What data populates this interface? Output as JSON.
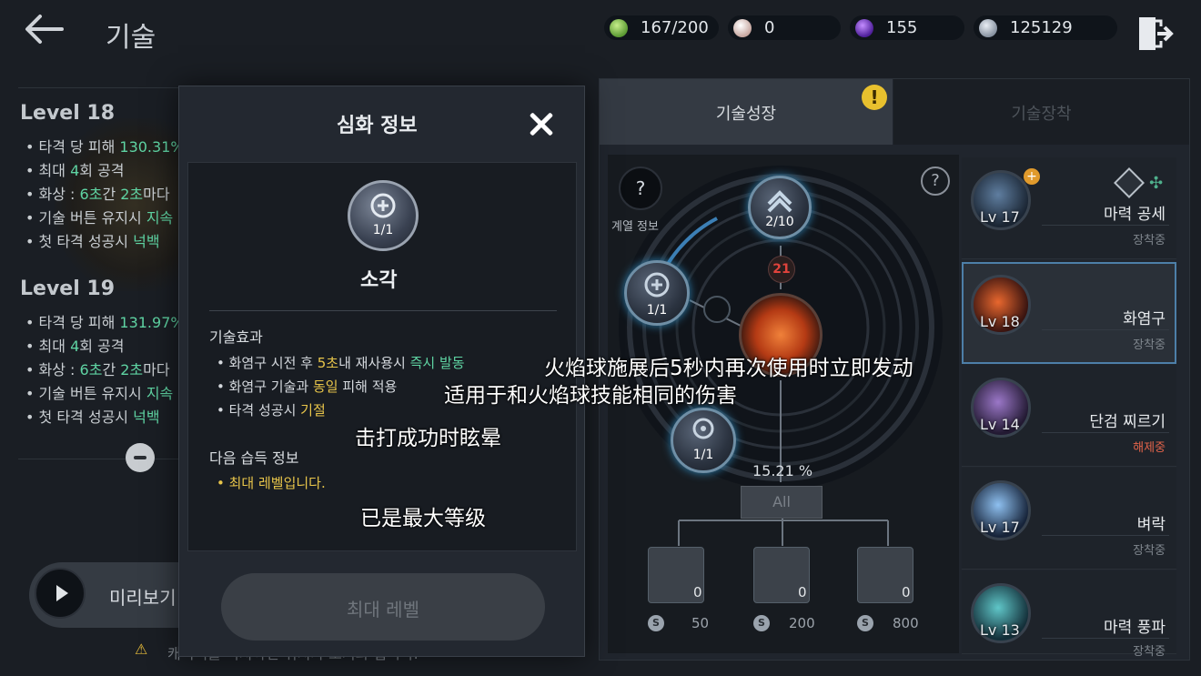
{
  "header": {
    "title": "기술"
  },
  "resources": [
    {
      "value": "167/200",
      "icon": "green-crystal-icon",
      "color": "#6bb04a"
    },
    {
      "value": "0",
      "icon": "pearl-icon",
      "color": "#e9d7d2"
    },
    {
      "value": "155",
      "icon": "purple-gem-icon",
      "color": "#7a3fd0"
    },
    {
      "value": "125129",
      "icon": "silver-coin-icon",
      "color": "#b8c0cc"
    }
  ],
  "levels": [
    {
      "title": "Level 18",
      "lines": [
        {
          "a": "• 타격 당 피해 ",
          "b": "130.31%",
          "c": ""
        },
        {
          "a": "• 최대 ",
          "b": "4",
          "c": "회 공격"
        },
        {
          "a": "• 화상 : ",
          "b": "6초",
          "c": "간 "
        },
        {
          "a": "• 기술 버튼 유지시 ",
          "b": "지속 발동",
          "c": ""
        },
        {
          "a": "• 첫 타격 성공시 ",
          "b": "넉백",
          "c": ""
        }
      ]
    },
    {
      "title": "Level 19",
      "lines": [
        {
          "a": "• 타격 당 피해 ",
          "b": "131.97%",
          "c": ""
        },
        {
          "a": "• 최대 ",
          "b": "4",
          "c": "회 공격"
        },
        {
          "a": "• 화상 : ",
          "b": "6초",
          "c": "간 "
        },
        {
          "a": "• 기술 버튼 유지시 ",
          "b": "지속 발동",
          "c": ""
        },
        {
          "a": "• 첫 타격 성공시 ",
          "b": "넉백",
          "c": ""
        }
      ]
    }
  ],
  "burn_extra": {
    "b": "2초",
    "c": "마다 "
  },
  "preview": {
    "label": "미리보기"
  },
  "hint": "캐릭터를 터치하면 위치가 초기화 됩니다.",
  "modal": {
    "title": "심화 정보",
    "skill_level": "1/1",
    "skill_name": "소각",
    "effect_header": "기술효과",
    "effects": [
      {
        "a": "• 화염구 시전 후 ",
        "b": "5초",
        "c": "내 재사용시 ",
        "d": "즉시 발동"
      },
      {
        "a": "• 화염구 기술과 ",
        "b": "동일",
        "c": " 피해 적용",
        "d": ""
      },
      {
        "a": "• 타격 성공시 ",
        "b": "기절",
        "c": "",
        "d": ""
      }
    ],
    "next_header": "다음 습득 정보",
    "next_value": "• 최대 레벨입니다.",
    "max_button": "최대 레벨"
  },
  "translations": [
    "火焰球施展后5秒内再次使用时立即发动",
    "适用于和火焰球技能相同的伤害",
    "击打成功时眩晕",
    "已是最大等级"
  ],
  "tabs": [
    {
      "label": "기술성장"
    },
    {
      "label": "기술장착"
    }
  ],
  "tree": {
    "help_label": "계열 정보",
    "top_node": "2/10",
    "red_count": "21",
    "left_node": "1/1",
    "bottom_node": "1/1",
    "percent": "15.21 %",
    "all_button": "All",
    "books": [
      {
        "count": "0",
        "cost": "50"
      },
      {
        "count": "0",
        "cost": "200"
      },
      {
        "count": "0",
        "cost": "800"
      }
    ]
  },
  "skills": [
    {
      "level": "Lv 17",
      "name": "마력 공세",
      "status": "장착중",
      "colors": [
        "#7fb6e6",
        "#1b2838"
      ]
    },
    {
      "level": "Lv 18",
      "name": "화염구",
      "status": "장착중",
      "colors": [
        "#e8672e",
        "#3a1410"
      ]
    },
    {
      "level": "Lv 14",
      "name": "단검 찌르기",
      "status": "해제중",
      "colors": [
        "#9b77c8",
        "#231a33"
      ]
    },
    {
      "level": "Lv 17",
      "name": "벼락",
      "status": "장착중",
      "colors": [
        "#8ec0f0",
        "#17243a"
      ]
    },
    {
      "level": "Lv 13",
      "name": "마력 풍파",
      "status": "장착중",
      "colors": [
        "#5fc6c8",
        "#14303a"
      ]
    }
  ]
}
